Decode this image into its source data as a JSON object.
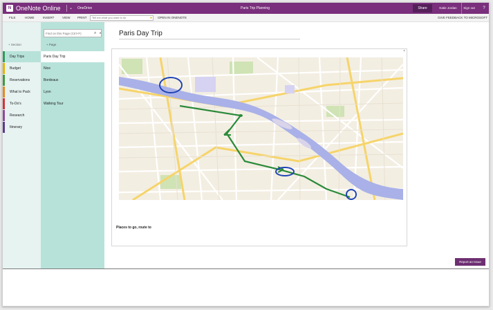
{
  "titlebar": {
    "logo_text": "N",
    "app_name": "OneNote Online",
    "breadcrumb": "OneDrive",
    "doc_title": "Paris Trip Planning",
    "share_label": "Share",
    "user_name": "Katie Jordan",
    "signout_label": "Sign out",
    "help_label": "?"
  },
  "menubar": {
    "items": [
      "FILE",
      "HOME",
      "INSERT",
      "VIEW",
      "PRINT"
    ],
    "tellme_placeholder": "Tell me what you want to do",
    "open_in_label": "OPEN IN ONENOTE",
    "feedback_label": "GIVE FEEDBACK TO MICROSOFT"
  },
  "sections": {
    "add_label": "Section",
    "items": [
      {
        "label": "Day Trips",
        "color": "#2f9a5e",
        "selected": true
      },
      {
        "label": "Budget",
        "color": "#e3b400",
        "selected": false
      },
      {
        "label": "Reservations",
        "color": "#3f9a3e",
        "selected": false
      },
      {
        "label": "What to Pack",
        "color": "#e58a1f",
        "selected": false
      },
      {
        "label": "To-Do's",
        "color": "#d13438",
        "selected": false
      },
      {
        "label": "Research",
        "color": "#8e4a9c",
        "selected": false
      },
      {
        "label": "Itinerary",
        "color": "#5b3a8c",
        "selected": false
      }
    ]
  },
  "pages": {
    "find_placeholder": "Find on this Page (Ctrl+F)",
    "add_label": "Page",
    "items": [
      {
        "label": "Paris Day Trip",
        "selected": true
      },
      {
        "label": "Nice",
        "selected": false
      },
      {
        "label": "Bordeaux",
        "selected": false
      },
      {
        "label": "Lyon",
        "selected": false
      },
      {
        "label": "Walking Tour",
        "selected": false
      }
    ]
  },
  "canvas": {
    "page_title": "Paris Day Trip",
    "note_text": "Places to go, route to",
    "report_label": "Report an Issue"
  },
  "colors": {
    "brand": "#7a2f7c",
    "section_pane": "#e6f3f1",
    "page_pane": "#b7e2d9",
    "river": "#a9b1e8",
    "route": "#2a8a3a",
    "marker": "#1f43b5"
  }
}
